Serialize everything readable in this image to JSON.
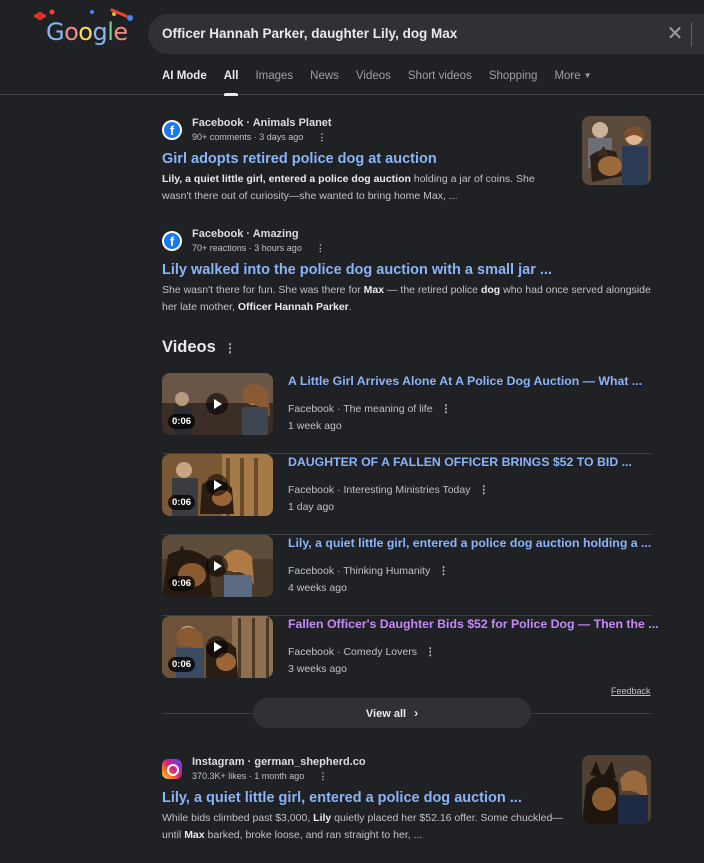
{
  "search": {
    "query": "Officer Hannah Parker, daughter Lily, dog Max",
    "clear_icon": "close-icon"
  },
  "tabs": [
    {
      "label": "AI Mode"
    },
    {
      "label": "All"
    },
    {
      "label": "Images"
    },
    {
      "label": "News"
    },
    {
      "label": "Videos"
    },
    {
      "label": "Short videos"
    },
    {
      "label": "Shopping"
    },
    {
      "label": "More"
    }
  ],
  "results": [
    {
      "source": "Facebook · Animals Planet",
      "meta": "90+ comments · 3 days ago",
      "title": "Girl adopts retired police dog at auction",
      "snippet": [
        {
          "t": "Lily, a quiet little girl, entered a police dog auction",
          "b": true
        },
        {
          "t": " holding a jar of coins. She wasn't there out of curiosity—she wanted to bring home Max, ...",
          "b": false
        }
      ]
    },
    {
      "source": "Facebook · Amazing",
      "meta": "70+ reactions · 3 hours ago",
      "title": "Lily walked into the police dog auction with a small jar ...",
      "snippet": [
        {
          "t": "She wasn't there for fun. She was there for ",
          "b": false
        },
        {
          "t": "Max",
          "b": true
        },
        {
          "t": " — the retired police ",
          "b": false
        },
        {
          "t": "dog",
          "b": true
        },
        {
          "t": " who had once served alongside her late mother, ",
          "b": false
        },
        {
          "t": "Officer Hannah Parker",
          "b": true
        },
        {
          "t": ".",
          "b": false
        }
      ]
    },
    {
      "source": "Instagram · german_shepherd.co",
      "meta": "370.3K+ likes · 1 month ago",
      "title": "Lily, a quiet little girl, entered a police dog auction ...",
      "snippet": [
        {
          "t": "While bids climbed past $3,000, ",
          "b": false
        },
        {
          "t": "Lily",
          "b": true
        },
        {
          "t": " quietly placed her $52.16 offer. Some chuckled—until ",
          "b": false
        },
        {
          "t": "Max",
          "b": true
        },
        {
          "t": " barked, broke loose, and ran straight to her, ...",
          "b": false
        }
      ]
    }
  ],
  "videos": {
    "heading": "Videos",
    "items": [
      {
        "title": "A Little Girl Arrives Alone At A Police Dog Auction — What ...",
        "source": "Facebook · The meaning of life",
        "time": "1 week ago",
        "duration": "0:06"
      },
      {
        "title": "DAUGHTER OF A FALLEN OFFICER BRINGS $52 TO BID ...",
        "source": "Facebook · Interesting Ministries Today",
        "time": "1 day ago",
        "duration": "0:06"
      },
      {
        "title": "Lily, a quiet little girl, entered a police dog auction holding a ...",
        "source": "Facebook · Thinking Humanity",
        "time": "4 weeks ago",
        "duration": "0:06"
      },
      {
        "title": "Fallen Officer's Daughter Bids $52 for Police Dog — Then the ...",
        "source": "Facebook · Comedy Lovers",
        "time": "3 weeks ago",
        "duration": "0:06"
      }
    ],
    "feedback": "Feedback",
    "view_all": "View all"
  }
}
